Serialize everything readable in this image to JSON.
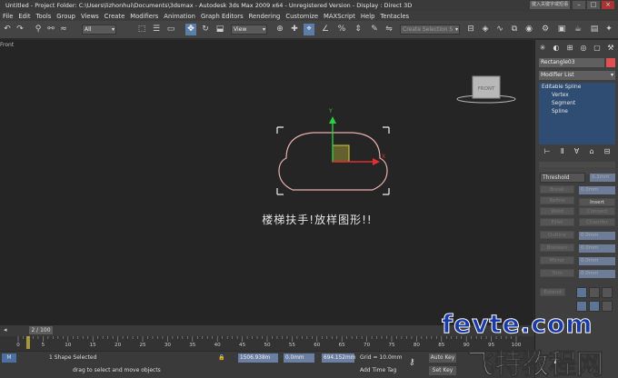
{
  "title": {
    "text": "Untitled    - Project Folder: C:\\Users\\lizhonhui\\Documents\\3dsmax   - Autodesk 3ds Max  2009 x64  - Unregistered Version         - Display : Direct 3D",
    "right_label": "键入关键字或短语"
  },
  "menu": [
    "File",
    "Edit",
    "Tools",
    "Group",
    "Views",
    "Create",
    "Modifiers",
    "Animation",
    "Graph Editors",
    "Rendering",
    "Customize",
    "MAXScript",
    "Help",
    "Tentacles"
  ],
  "toolbar": {
    "selection_filter": "All",
    "ref_coord": "View",
    "named_selection": "Create Selection S"
  },
  "viewport": {
    "label": "Front",
    "viewcube_label": "FRONT",
    "caption": "楼梯扶手!放样图形!!",
    "accent_colors": {
      "spline": "#e8b0b0",
      "y_axis": "#2ecc40",
      "x_axis": "#e03030",
      "gizmo": "#d8d040"
    }
  },
  "command_panel": {
    "object_name": "Rectangle03",
    "object_color": "#e05050",
    "modifier_list": "Modifier List",
    "stack": [
      "Editable Spline",
      "Vertex",
      "Segment",
      "Spline"
    ],
    "threshold_label": "Threshold",
    "insert_button": "Insert",
    "buttons": [
      "Break",
      "Refine",
      "Weld",
      "Connect",
      "Fillet",
      "Chamfer",
      "Outline",
      "Boolean",
      "Mirror",
      "Trim",
      "Extend"
    ],
    "spinners": [
      "0.1mm",
      "0.0mm",
      "0.0mm",
      "0.0mm",
      "0.0mm",
      "0.0mm"
    ]
  },
  "timeline": {
    "slider_label": "2 / 100",
    "ticks": [
      "0",
      "5",
      "10",
      "15",
      "20",
      "25",
      "30",
      "35",
      "40",
      "45",
      "50",
      "55",
      "60",
      "65",
      "70",
      "75",
      "80",
      "85",
      "90",
      "95",
      "100"
    ]
  },
  "status": {
    "taskbar_btn": "M",
    "selection": "1 Shape Selected",
    "prompt": "drag to select and move objects",
    "x_value": "1506.938m",
    "y_value": "0.0mm",
    "z_value": "694.152mm",
    "grid": "Grid = 10.0mm",
    "add_time_tag": "Add Time Tag",
    "auto_key": "Auto Key",
    "set_key": "Set Key"
  },
  "watermark": {
    "top": "fevte.com",
    "bottom": "飞特教程网"
  }
}
